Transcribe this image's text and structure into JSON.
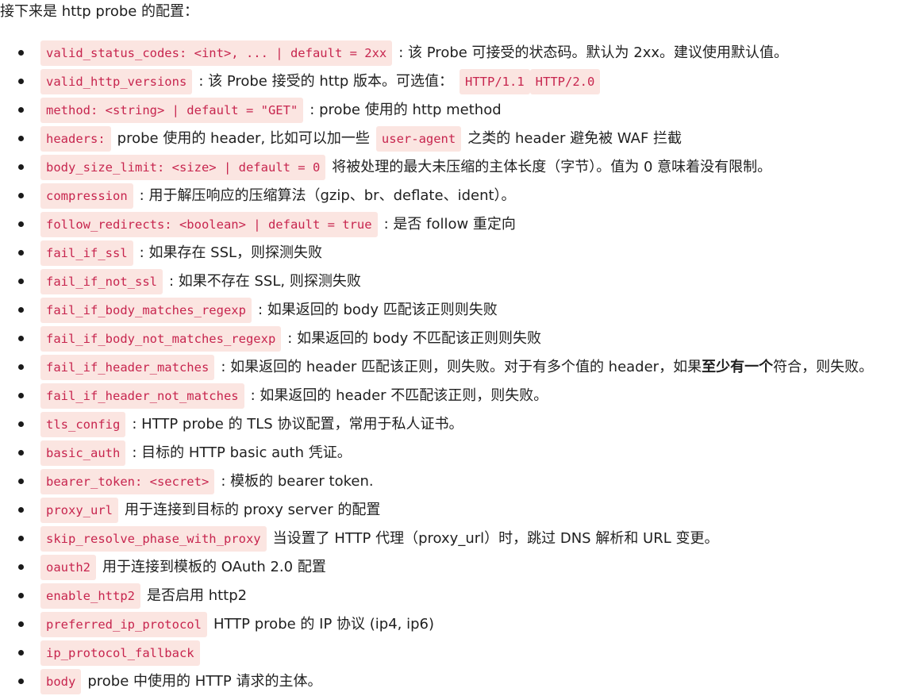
{
  "intro": "接下来是 http probe 的配置：",
  "items": [
    {
      "parts": [
        {
          "code": "valid_status_codes: <int>, ... | default = 2xx"
        },
        {
          "text": ": 该 Probe 可接受的状态码。默认为 2xx。建议使用默认值。"
        }
      ]
    },
    {
      "parts": [
        {
          "code": "valid_http_versions"
        },
        {
          "text": ": 该 Probe 接受的 http 版本。可选值："
        },
        {
          "code": "HTTP/1.1"
        },
        {
          "code": "HTTP/2.0"
        }
      ]
    },
    {
      "parts": [
        {
          "code": "method: <string> | default = \"GET\""
        },
        {
          "text": ": probe 使用的 http method"
        }
      ]
    },
    {
      "parts": [
        {
          "code": "headers:"
        },
        {
          "text": "probe 使用的 header, 比如可以加一些"
        },
        {
          "code": "user-agent"
        },
        {
          "text": "之类的 header 避免被 WAF 拦截"
        }
      ]
    },
    {
      "parts": [
        {
          "code": "body_size_limit: <size> | default = 0"
        },
        {
          "text": "将被处理的最大未压缩的主体长度（字节）。值为 0 意味着没有限制。"
        }
      ]
    },
    {
      "parts": [
        {
          "code": "compression"
        },
        {
          "text": ": 用于解压响应的压缩算法（gzip、br、deflate、ident）。"
        }
      ]
    },
    {
      "parts": [
        {
          "code": "follow_redirects: <boolean> | default = true"
        },
        {
          "text": ": 是否 follow 重定向"
        }
      ]
    },
    {
      "parts": [
        {
          "code": "fail_if_ssl"
        },
        {
          "text": ": 如果存在 SSL，则探测失败"
        }
      ]
    },
    {
      "parts": [
        {
          "code": "fail_if_not_ssl"
        },
        {
          "text": ": 如果不存在 SSL, 则探测失败"
        }
      ]
    },
    {
      "parts": [
        {
          "code": "fail_if_body_matches_regexp"
        },
        {
          "text": ": 如果返回的 body 匹配该正则则失败"
        }
      ]
    },
    {
      "parts": [
        {
          "code": "fail_if_body_not_matches_regexp"
        },
        {
          "text": ": 如果返回的 body 不匹配该正则则失败"
        }
      ]
    },
    {
      "parts": [
        {
          "code": "fail_if_header_matches"
        },
        {
          "text": ": 如果返回的 header 匹配该正则，则失败。对于有多个值的 header，如果"
        },
        {
          "bold": "至少有一个"
        },
        {
          "text": "符合，则失败。"
        }
      ]
    },
    {
      "parts": [
        {
          "code": "fail_if_header_not_matches"
        },
        {
          "text": ": 如果返回的 header 不匹配该正则，则失败。"
        }
      ]
    },
    {
      "parts": [
        {
          "code": "tls_config"
        },
        {
          "text": ": HTTP probe 的 TLS 协议配置，常用于私人证书。"
        }
      ]
    },
    {
      "parts": [
        {
          "code": "basic_auth"
        },
        {
          "text": ": 目标的 HTTP basic auth 凭证。"
        }
      ]
    },
    {
      "parts": [
        {
          "code": "bearer_token: <secret>"
        },
        {
          "text": ": 模板的 bearer token."
        }
      ]
    },
    {
      "parts": [
        {
          "code": "proxy_url"
        },
        {
          "text": "用于连接到目标的 proxy server 的配置"
        }
      ]
    },
    {
      "parts": [
        {
          "code": "skip_resolve_phase_with_proxy"
        },
        {
          "text": "当设置了 HTTP 代理（proxy_url）时，跳过 DNS 解析和 URL 变更。"
        }
      ]
    },
    {
      "parts": [
        {
          "code": "oauth2"
        },
        {
          "text": "用于连接到模板的 OAuth 2.0 配置"
        }
      ]
    },
    {
      "parts": [
        {
          "code": "enable_http2"
        },
        {
          "text": "是否启用 http2"
        }
      ]
    },
    {
      "parts": [
        {
          "code": "preferred_ip_protocol"
        },
        {
          "text": "HTTP probe 的 IP 协议 (ip4, ip6)"
        }
      ]
    },
    {
      "parts": [
        {
          "code": "ip_protocol_fallback"
        }
      ]
    },
    {
      "parts": [
        {
          "code": "body"
        },
        {
          "text": "probe 中使用的 HTTP 请求的主体。"
        }
      ]
    }
  ]
}
